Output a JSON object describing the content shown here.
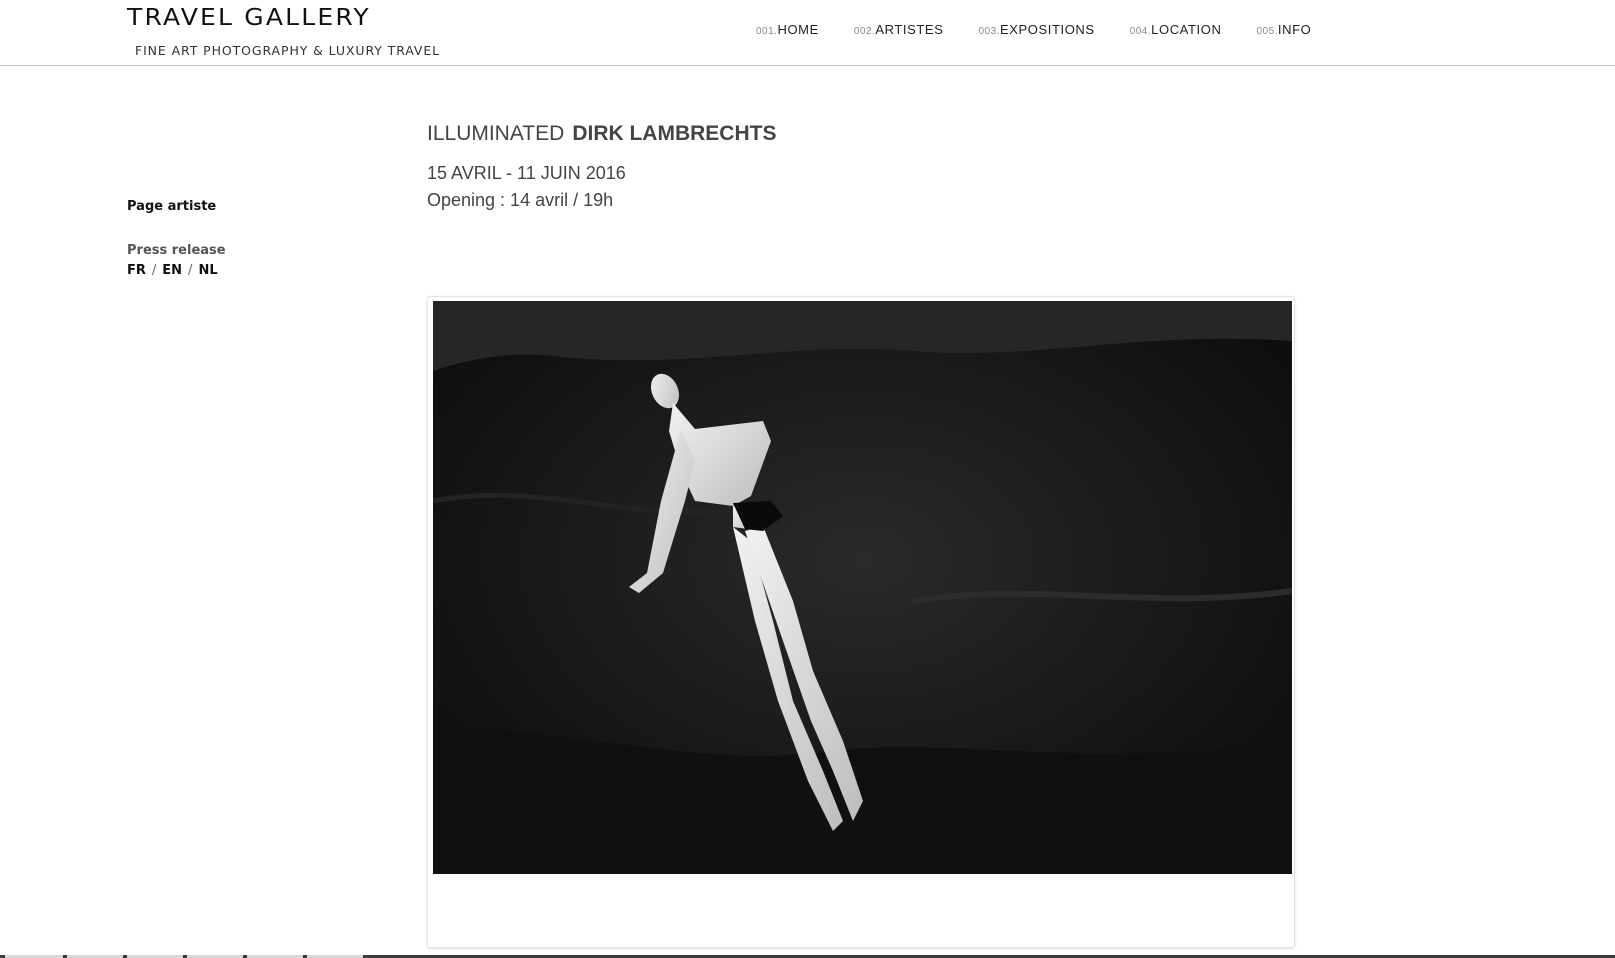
{
  "header": {
    "logo_title": "TRAVEL GALLERY",
    "logo_subtitle": "FINE ART PHOTOGRAPHY & LUXURY TRAVEL",
    "nav": [
      {
        "num": "001.",
        "label": "HOME"
      },
      {
        "num": "002.",
        "label": "ARTISTES"
      },
      {
        "num": "003.",
        "label": "EXPOSITIONS"
      },
      {
        "num": "004.",
        "label": "LOCATION"
      },
      {
        "num": "005.",
        "label": "INFO"
      }
    ]
  },
  "sidebar": {
    "artist_page": "Page artiste",
    "press_release": "Press release",
    "langs": [
      "FR",
      "EN",
      "NL"
    ],
    "sep": "/"
  },
  "exhibition": {
    "title_prefix": "ILLUMINATED",
    "artist": "DIRK LAMBRECHTS",
    "dates": "15 AVRIL - 11 JUIN 2016",
    "opening": "Opening : 14 avril / 19h"
  },
  "colors": {
    "text": "#444444",
    "nav_num": "#888888",
    "photo_bg": "#1a1a1a"
  }
}
